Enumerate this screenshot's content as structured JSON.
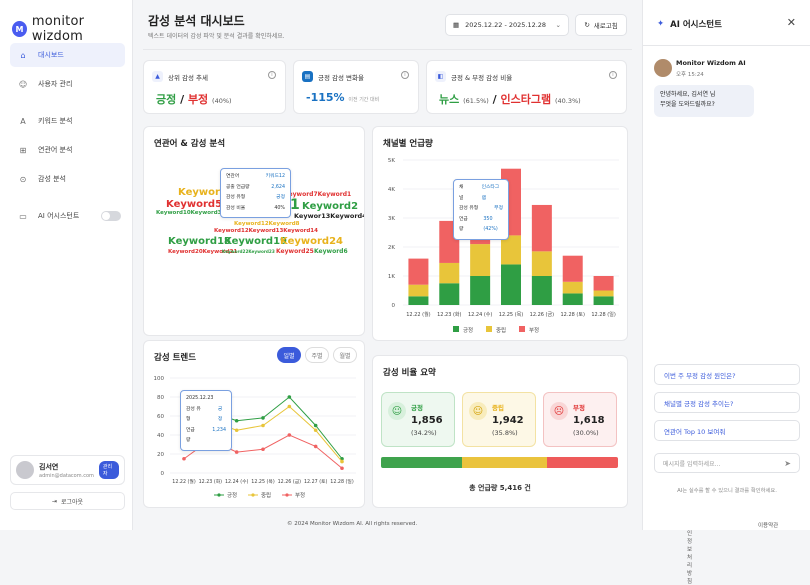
{
  "app": {
    "logo_mark": "M",
    "logo": "monitor wizdom"
  },
  "nav": [
    {
      "icon": "⌂",
      "label": "대시보드"
    },
    {
      "icon": "☺",
      "label": "사용자 관리"
    },
    {
      "icon": "A",
      "label": "키워드 분석"
    },
    {
      "icon": "⊞",
      "label": "연관어 분석"
    },
    {
      "icon": "⊙",
      "label": "감성 분석"
    },
    {
      "icon": "▭",
      "label": "AI 어시스턴트"
    }
  ],
  "user": {
    "name": "김서연",
    "email": "admin@datacom.com",
    "badge": "관리자",
    "logout": "로그아웃"
  },
  "header": {
    "title": "감성 분석 대시보드",
    "subtitle": "텍스트 데이터의 감성 파악 및 분석 결과를 확인하세요.",
    "date_range": "2025.12.22 - 2025.12.28",
    "refresh": "새로고침",
    "calendar_icon": "▦",
    "chevron_icon": "⌄",
    "refresh_icon": "↻"
  },
  "kpi": [
    {
      "title": "상위 감성 추세",
      "icon": "▲",
      "value_a": "긍정",
      "sep": " / ",
      "value_b": "부정",
      "note": "(40%)"
    },
    {
      "title": "긍정 감성 변화율",
      "icon": "▤",
      "value": "-115%",
      "note": "이전 기간 대비"
    },
    {
      "title": "긍정 & 부정 감성 비율",
      "icon": "◧",
      "value_a": "뉴스",
      "note_a": "(61.5%)",
      "sep": " / ",
      "value_b": "인스타그램",
      "note_b": "(40.3%)"
    }
  ],
  "wordcloud": {
    "title": "연관어 & 감성 분석",
    "words": [
      {
        "text": "Keyword",
        "color": "#e8b21c"
      },
      {
        "text": "Keyword7Keyword1",
        "color": "#e03131"
      },
      {
        "text": "Keyword5",
        "color": "#e03131"
      },
      {
        "text": "1",
        "color": "#2f9e44"
      },
      {
        "text": "Keyword2",
        "color": "#2f9e44"
      },
      {
        "text": "Keyword10Keyword3",
        "color": "#2f9e44"
      },
      {
        "text": "Keywor13Keyword4",
        "color": "#222"
      },
      {
        "text": "Keyword12Keyword13Keyword14",
        "color": "#e03131"
      },
      {
        "text": "Keyword18",
        "color": "#2f9e44"
      },
      {
        "text": "Keyword19",
        "color": "#2f9e44"
      },
      {
        "text": "Keyword24",
        "color": "#e8b21c"
      },
      {
        "text": "Keyword20Keyword21",
        "color": "#e03131"
      },
      {
        "text": "Keyword22Keyword23",
        "color": "#2f9e44"
      },
      {
        "text": "Keyword25",
        "color": "#e03131"
      },
      {
        "text": "Keyword6",
        "color": "#2f9e44"
      },
      {
        "text": "Keyword12Keyword8",
        "color": "#e8b21c"
      }
    ],
    "tooltip": [
      {
        "k": "연관어",
        "v": "키워드12"
      },
      {
        "k": "공출 언급량",
        "v": "2,624"
      },
      {
        "k": "감성 유형",
        "v": "긍정"
      },
      {
        "k": "감성 비율",
        "v": "40%"
      }
    ]
  },
  "channel": {
    "title": "채널별 언급량",
    "tooltip": [
      {
        "k": "채널",
        "v": "인스타그램"
      },
      {
        "k": "감성 유형",
        "v": "부정"
      },
      {
        "k": "언급량",
        "v": "350 (42%)"
      }
    ],
    "legend": [
      "긍정",
      "중립",
      "부정"
    ]
  },
  "trend": {
    "title": "감성 트렌드",
    "tabs": [
      "일별",
      "주별",
      "월별"
    ],
    "tooltip": [
      {
        "k": "2025.12.23",
        "v": ""
      },
      {
        "k": "감성 유형",
        "v": "긍정"
      },
      {
        "k": "언급량",
        "v": "1,234"
      }
    ],
    "legend": [
      "긍정",
      "중립",
      "부정"
    ]
  },
  "ratio": {
    "title": "감성 비율 요약",
    "items": [
      {
        "label": "긍정",
        "count": "1,856",
        "pct": "(34.2%)",
        "face": "☺"
      },
      {
        "label": "중립",
        "count": "1,942",
        "pct": "(35.8%)",
        "face": "☺"
      },
      {
        "label": "부정",
        "count": "1,618",
        "pct": "(30.0%)",
        "face": "☹"
      }
    ],
    "total": "총 언급량  5,416 건"
  },
  "footer": {
    "copyright": "© 2024 Monitor Wizdom AI. All rights reserved.",
    "privacy": "개인정보처리방침",
    "terms": "이용약관"
  },
  "assistant": {
    "title": "AI 어시스턴트",
    "title_icon": "✦",
    "close_icon": "✕",
    "bot_name": "Monitor Wizdom AI",
    "time": "오후 15:24",
    "greeting_1": "안녕하세요, 김서연 님",
    "greeting_2": "무엇을 도와드릴까요?",
    "suggestions": [
      "이번 주 부정 감성 원인은?",
      "채널별 긍정 감성 추이는?",
      "연관어 Top 10 보여줘"
    ],
    "input_placeholder": "메시지를 입력하세요...",
    "send_icon": "➤",
    "disclaimer": "AI는 실수를 할 수 있으니 결과를 확인하세요."
  },
  "colors": {
    "positive": "#2f9e44",
    "neutral": "#e8c53a",
    "negative": "#f06262",
    "accent": "#3b5bdb"
  },
  "chart_data": [
    {
      "type": "bar",
      "stacked": true,
      "title": "채널별 언급량",
      "categories": [
        "12.22 (월)",
        "12.23 (화)",
        "12.24 (수)",
        "12.25 (목)",
        "12.26 (금)",
        "12.28 (토)",
        "12.28 (일)"
      ],
      "y_ticks": [
        "0",
        "1K",
        "2K",
        "3K",
        "4K",
        "5K"
      ],
      "ylim": [
        0,
        5000
      ],
      "series": [
        {
          "name": "긍정",
          "values": [
            300,
            750,
            1000,
            1400,
            1000,
            400,
            300
          ]
        },
        {
          "name": "중립",
          "values": [
            400,
            700,
            1100,
            1000,
            850,
            400,
            200
          ]
        },
        {
          "name": "부정",
          "values": [
            900,
            1450,
            1900,
            2300,
            1600,
            900,
            500
          ]
        }
      ]
    },
    {
      "type": "line",
      "title": "감성 트렌드",
      "categories": [
        "12.22 (월)",
        "12.23 (화)",
        "12.24 (수)",
        "12.25 (목)",
        "12.26 (금)",
        "12.27 (토)",
        "12.28 (일)"
      ],
      "y_ticks": [
        "0",
        "20",
        "40",
        "60",
        "80",
        "100"
      ],
      "ylim": [
        0,
        100
      ],
      "series": [
        {
          "name": "긍정",
          "values": [
            45,
            65,
            55,
            58,
            80,
            50,
            15
          ]
        },
        {
          "name": "중립",
          "values": [
            38,
            55,
            45,
            50,
            70,
            45,
            12
          ]
        },
        {
          "name": "부정",
          "values": [
            15,
            35,
            22,
            25,
            40,
            28,
            5
          ]
        }
      ]
    }
  ]
}
